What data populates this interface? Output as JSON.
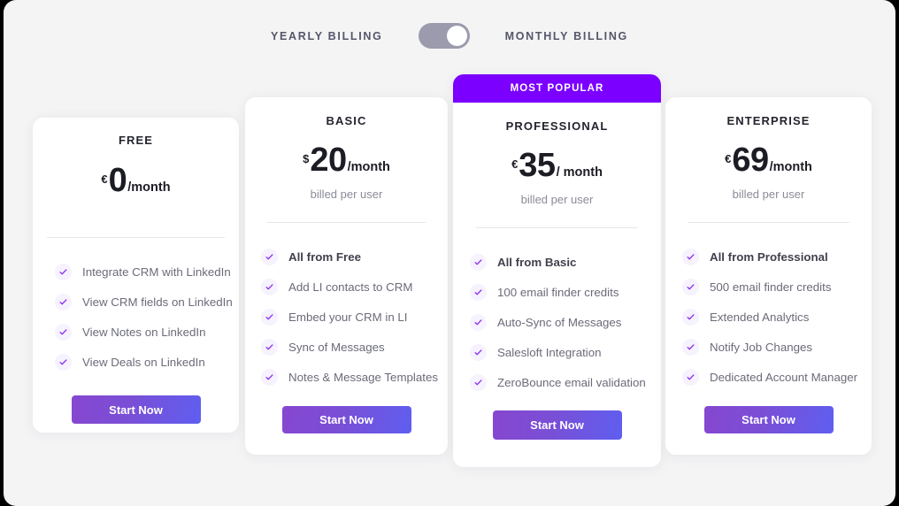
{
  "billing": {
    "yearly_label": "YEARLY BILLING",
    "monthly_label": "MONTHLY BILLING",
    "selected": "MONTHLY BILLING"
  },
  "colors": {
    "page_background": "#f4f4f5",
    "card_background": "#ffffff",
    "ribbon": "#7b00ff",
    "cta_gradient_start": "#8647cf",
    "cta_gradient_end": "#5f5ef0",
    "check_mark": "#8b2df0",
    "check_circle": "#f6f2fe",
    "feature_text": "#6b6b7a",
    "toggle_track": "#9b9bad",
    "toggle_knob": "#ffffff"
  },
  "plans": [
    {
      "name": "FREE",
      "currency": "€",
      "amount": "0",
      "per": "/month",
      "billed": "",
      "badge": "",
      "cta": "Start Now",
      "features": [
        {
          "text": "Integrate CRM with LinkedIn",
          "strong": false
        },
        {
          "text": "View CRM fields on LinkedIn",
          "strong": false
        },
        {
          "text": "View Notes on LinkedIn",
          "strong": false
        },
        {
          "text": "View Deals on LinkedIn",
          "strong": false
        }
      ]
    },
    {
      "name": "BASIC",
      "currency": "$",
      "amount": "20",
      "per": "/month",
      "billed": "billed per user",
      "badge": "",
      "cta": "Start Now",
      "features": [
        {
          "text": "All from Free",
          "strong": true
        },
        {
          "text": "Add LI contacts to CRM",
          "strong": false
        },
        {
          "text": "Embed your CRM in LI",
          "strong": false
        },
        {
          "text": "Sync of Messages",
          "strong": false
        },
        {
          "text": "Notes & Message Templates",
          "strong": false
        }
      ]
    },
    {
      "name": "PROFESSIONAL",
      "currency": "€",
      "amount": "35",
      "per": "/ month",
      "billed": "billed per user",
      "badge": "MOST POPULAR",
      "cta": "Start Now",
      "features": [
        {
          "text": "All from Basic",
          "strong": true
        },
        {
          "text": "100 email finder credits",
          "strong": false
        },
        {
          "text": "Auto-Sync of Messages",
          "strong": false
        },
        {
          "text": "Salesloft Integration",
          "strong": false
        },
        {
          "text": "ZeroBounce email validation",
          "strong": false
        }
      ]
    },
    {
      "name": "ENTERPRISE",
      "currency": "€",
      "amount": "69",
      "per": "/month",
      "billed": "billed per user",
      "badge": "",
      "cta": "Start Now",
      "features": [
        {
          "text": "All from Professional",
          "strong": true
        },
        {
          "text": "500 email finder credits",
          "strong": false
        },
        {
          "text": "Extended Analytics",
          "strong": false
        },
        {
          "text": "Notify Job Changes",
          "strong": false
        },
        {
          "text": "Dedicated Account Manager",
          "strong": false
        }
      ]
    }
  ]
}
